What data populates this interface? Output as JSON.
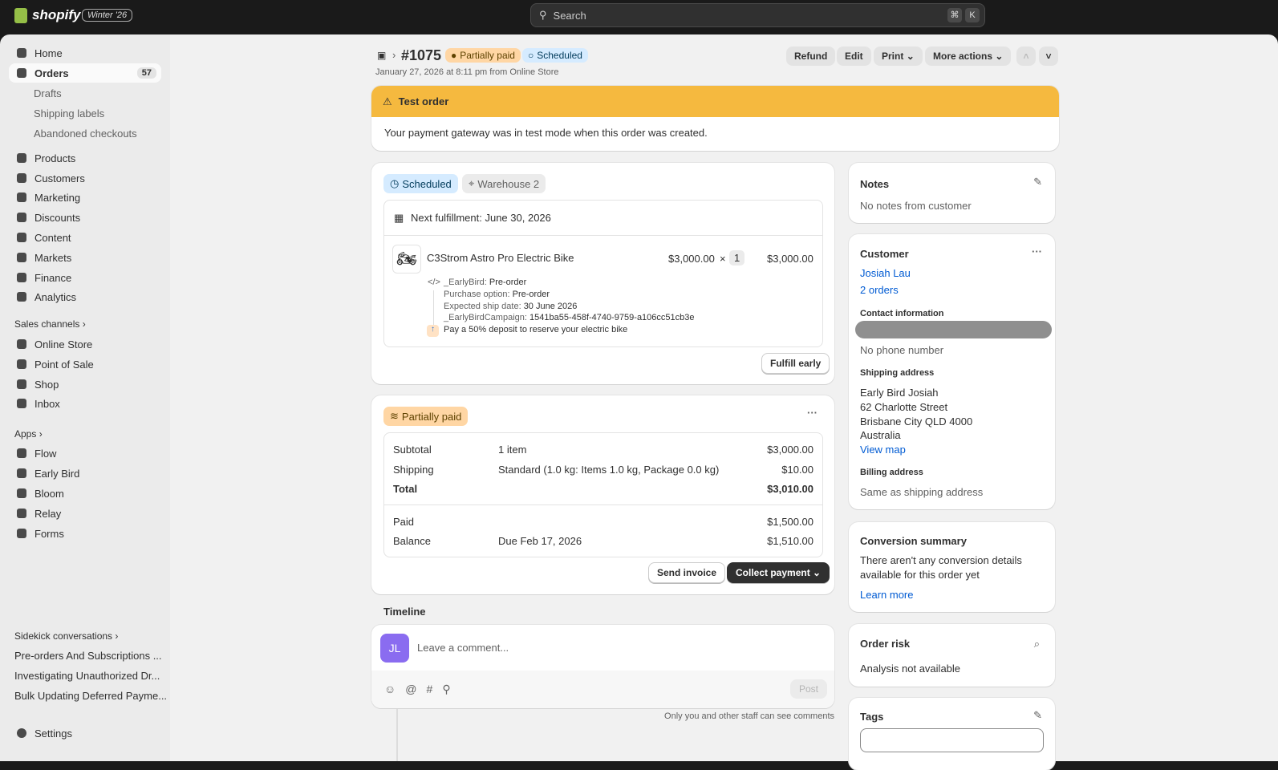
{
  "topbar": {
    "brand": "shopify",
    "edition": "Winter '26",
    "search_placeholder": "Search",
    "shortcut": [
      "⌘",
      "K"
    ]
  },
  "sidebar": {
    "items": [
      {
        "label": "Home"
      },
      {
        "label": "Orders",
        "count": "57"
      },
      {
        "label": "Drafts"
      },
      {
        "label": "Shipping labels"
      },
      {
        "label": "Abandoned checkouts"
      },
      {
        "label": "Products"
      },
      {
        "label": "Customers"
      },
      {
        "label": "Marketing"
      },
      {
        "label": "Discounts"
      },
      {
        "label": "Content"
      },
      {
        "label": "Markets"
      },
      {
        "label": "Finance"
      },
      {
        "label": "Analytics"
      }
    ],
    "sales_channels_label": "Sales channels",
    "channels": [
      "Online Store",
      "Point of Sale",
      "Shop",
      "Inbox"
    ],
    "apps_label": "Apps",
    "apps": [
      "Flow",
      "Early Bird",
      "Bloom",
      "Relay",
      "Forms"
    ],
    "sidekick_label": "Sidekick conversations",
    "sidekick": [
      "Pre-orders And Subscriptions ...",
      "Investigating Unauthorized Dr...",
      "Bulk Updating Deferred Payme..."
    ],
    "settings": "Settings"
  },
  "order": {
    "number": "#1075",
    "payment_status": "Partially paid",
    "fulfillment_status": "Scheduled",
    "subtitle": "January 27, 2026 at 8:11 pm from Online Store",
    "actions": {
      "refund": "Refund",
      "edit": "Edit",
      "print": "Print",
      "more": "More actions"
    }
  },
  "test_banner": {
    "title": "Test order",
    "body": "Your payment gateway was in test mode when this order was created."
  },
  "fulfillment": {
    "status": "Scheduled",
    "location": "Warehouse 2",
    "next": "Next fulfillment: June 30, 2026",
    "item": {
      "name": "C3Strom Astro Pro Electric Bike",
      "price": "$3,000.00",
      "times": "×",
      "qty": "1",
      "total": "$3,000.00",
      "props": [
        {
          "k": "_EarlyBird:",
          "v": "Pre-order"
        },
        {
          "k": "Purchase option:",
          "v": "Pre-order"
        },
        {
          "k": "Expected ship date:",
          "v": "30 June 2026"
        },
        {
          "k": "_EarlyBirdCampaign:",
          "v": "1541ba55-458f-4740-9759-a106cc51cb3e"
        }
      ],
      "note": "Pay a 50% deposit to reserve your electric bike"
    },
    "fulfill_early": "Fulfill early"
  },
  "payment": {
    "status": "Partially paid",
    "rows": [
      {
        "label": "Subtotal",
        "desc": "1 item",
        "amount": "$3,000.00"
      },
      {
        "label": "Shipping",
        "desc": "Standard (1.0 kg: Items 1.0 kg, Package 0.0 kg)",
        "amount": "$10.00"
      },
      {
        "label": "Total",
        "desc": "",
        "amount": "$3,010.00"
      }
    ],
    "paid": {
      "label": "Paid",
      "amount": "$1,500.00"
    },
    "balance": {
      "label": "Balance",
      "desc": "Due Feb 17, 2026",
      "amount": "$1,510.00"
    },
    "send_invoice": "Send invoice",
    "collect": "Collect payment"
  },
  "timeline": {
    "title": "Timeline",
    "avatar": "JL",
    "placeholder": "Leave a comment...",
    "post": "Post",
    "note": "Only you and other staff can see comments"
  },
  "notes": {
    "title": "Notes",
    "body": "No notes from customer"
  },
  "customer": {
    "title": "Customer",
    "name": "Josiah Lau",
    "orders": "2 orders",
    "contact_title": "Contact information",
    "phone": "No phone number",
    "shipping_title": "Shipping address",
    "address": [
      "Early Bird Josiah",
      "62 Charlotte Street",
      "Brisbane City QLD 4000",
      "Australia"
    ],
    "view_map": "View map",
    "billing_title": "Billing address",
    "billing": "Same as shipping address"
  },
  "conversion": {
    "title": "Conversion summary",
    "body1": "There aren't any conversion details",
    "body2": "available for this order yet",
    "link": "Learn more"
  },
  "risk": {
    "title": "Order risk",
    "body": "Analysis not available"
  },
  "tags": {
    "title": "Tags"
  }
}
